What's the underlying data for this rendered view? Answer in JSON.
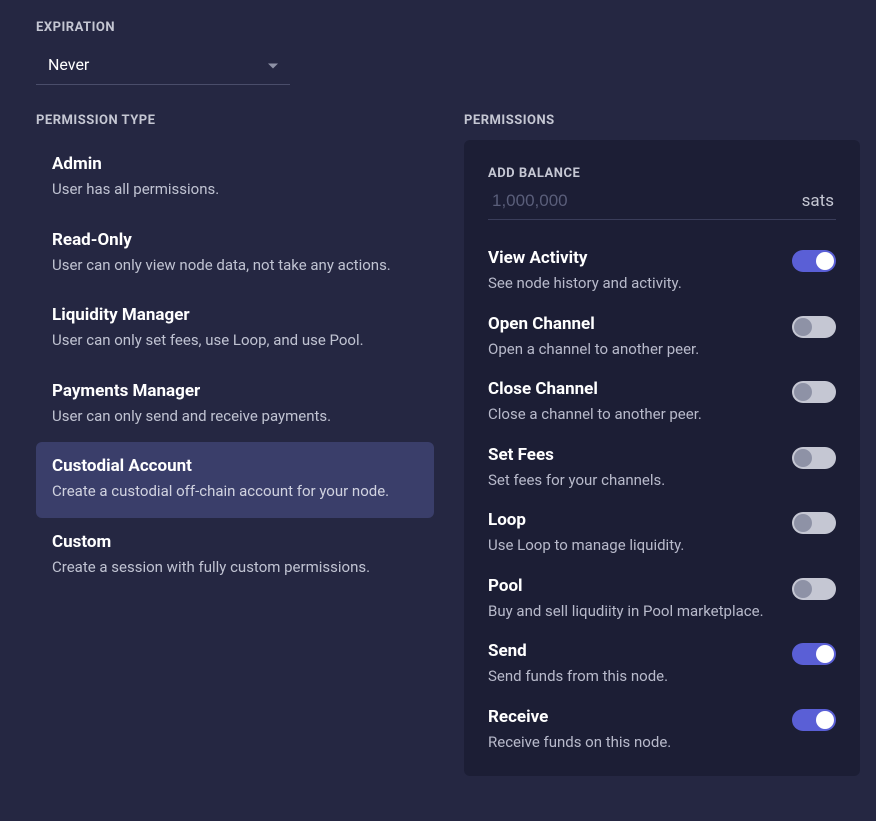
{
  "expiration": {
    "label": "EXPIRATION",
    "value": "Never"
  },
  "permissionType": {
    "label": "PERMISSION TYPE",
    "selectedIndex": 4,
    "items": [
      {
        "title": "Admin",
        "desc": "User has all permissions."
      },
      {
        "title": "Read-Only",
        "desc": "User can only view node data, not take any actions."
      },
      {
        "title": "Liquidity Manager",
        "desc": "User can only set fees, use Loop, and use Pool."
      },
      {
        "title": "Payments Manager",
        "desc": "User can only send and receive payments."
      },
      {
        "title": "Custodial Account",
        "desc": "Create a custodial off-chain account for your node."
      },
      {
        "title": "Custom",
        "desc": "Create a session with fully custom permissions."
      }
    ]
  },
  "permissions": {
    "label": "PERMISSIONS",
    "addBalance": {
      "label": "ADD BALANCE",
      "placeholder": "1,000,000",
      "unit": "sats",
      "value": ""
    },
    "toggles": [
      {
        "title": "View Activity",
        "desc": "See node history and activity.",
        "on": true
      },
      {
        "title": "Open Channel",
        "desc": "Open a channel to another peer.",
        "on": false
      },
      {
        "title": "Close Channel",
        "desc": "Close a channel to another peer.",
        "on": false
      },
      {
        "title": "Set Fees",
        "desc": "Set fees for your channels.",
        "on": false
      },
      {
        "title": "Loop",
        "desc": "Use Loop to manage liquidity.",
        "on": false
      },
      {
        "title": "Pool",
        "desc": "Buy and sell liqudiity in Pool marketplace.",
        "on": false
      },
      {
        "title": "Send",
        "desc": "Send funds from this node.",
        "on": true
      },
      {
        "title": "Receive",
        "desc": "Receive funds on this node.",
        "on": true
      }
    ]
  }
}
